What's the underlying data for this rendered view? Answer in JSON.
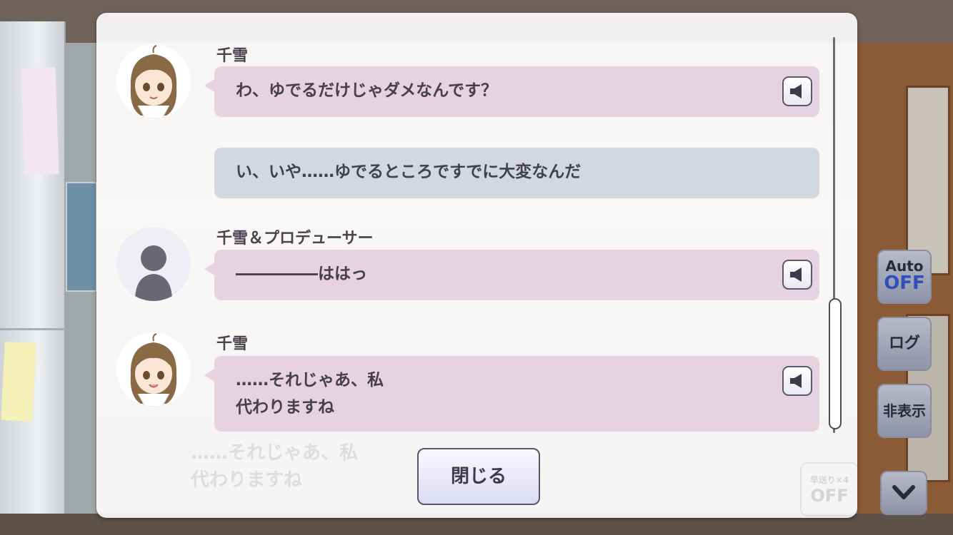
{
  "log": {
    "entries": [
      {
        "speaker": "千雪",
        "text": "わ、ゆでるだけじゃダメなんです？",
        "style": "pink",
        "has_voice": true,
        "avatar": "chiyuki-portrait"
      },
      {
        "speaker": "",
        "text": "い、いや……ゆでるところですでに大変なんだ",
        "style": "gray",
        "has_voice": false,
        "avatar": ""
      },
      {
        "speaker": "千雪＆プロデューサー",
        "text": "―――――ははっ",
        "style": "pink",
        "has_voice": true,
        "avatar": "silhouette"
      },
      {
        "speaker": "千雪",
        "text": "……それじゃあ、私\n代わりますね",
        "style": "pink",
        "has_voice": true,
        "avatar": "chiyuki-portrait"
      }
    ],
    "close_label": "閉じる"
  },
  "background": {
    "dialogue_text": "……それじゃあ、私\n代わりますね",
    "fast_forward_label": "早送り×4",
    "fast_forward_state": "OFF"
  },
  "side_controls": {
    "auto_label": "Auto",
    "auto_state": "OFF",
    "log_label": "ログ",
    "hide_label": "非表示"
  },
  "colors": {
    "speaker_bubble": "#e7d3df",
    "player_bubble": "#d3d7df",
    "auto_off": "#2e50b8"
  }
}
